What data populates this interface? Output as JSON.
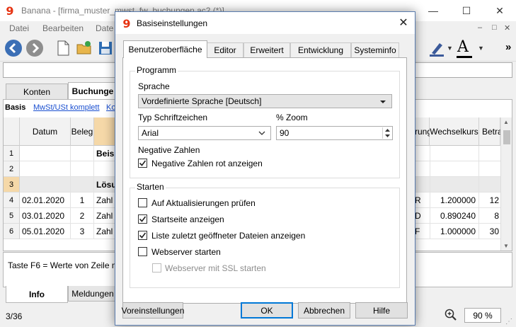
{
  "window": {
    "title": "Banana - [firma_muster_mwst_fw_buchungen.ac2 (*)]",
    "controls": {
      "minimize": "—",
      "maximize": "☐",
      "close": "✕"
    }
  },
  "menu": [
    "Datei",
    "Bearbeiten",
    "Date"
  ],
  "mdi_controls": [
    "‒",
    "□",
    "✕"
  ],
  "toolbar": {
    "more": "»",
    "font_letter": "A"
  },
  "table_tabs": [
    "Konten",
    "Buchunge"
  ],
  "views": [
    "Basis",
    "MwSt/USt komplett",
    "Ko"
  ],
  "columns": {
    "datum": "Datum",
    "beleg": "Beleg",
    "waehrung": "rung",
    "wechselkurs": "Wechselkurs",
    "betrag": "Betra"
  },
  "rows": [
    {
      "num": "1",
      "datum": "",
      "beleg": "",
      "text": "Beis",
      "whg": "",
      "kurs": "",
      "betrag": ""
    },
    {
      "num": "2",
      "datum": "",
      "beleg": "",
      "text": "",
      "whg": "",
      "kurs": "",
      "betrag": ""
    },
    {
      "num": "3",
      "datum": "",
      "beleg": "",
      "text": "Lösu",
      "whg": "",
      "kurs": "",
      "betrag": ""
    },
    {
      "num": "4",
      "datum": "02.01.2020",
      "beleg": "1",
      "text": "Zahl",
      "whg": "R",
      "kurs": "1.200000",
      "betrag": "12"
    },
    {
      "num": "5",
      "datum": "03.01.2020",
      "beleg": "2",
      "text": "Zahl",
      "whg": "D",
      "kurs": "0.890240",
      "betrag": "8"
    },
    {
      "num": "6",
      "datum": "05.01.2020",
      "beleg": "3",
      "text": "Zahl",
      "whg": "F",
      "kurs": "1.000000",
      "betrag": "30"
    }
  ],
  "info": {
    "text": "Taste F6 = Werte von Zeile mit"
  },
  "bottom_tabs": [
    "Info",
    "Meldungen"
  ],
  "status": {
    "position": "3/36",
    "zoom": "90 %"
  },
  "dialog": {
    "title": "Basiseinstellungen",
    "tabs": [
      "Benutzeroberfläche",
      "Editor",
      "Erweitert",
      "Entwicklung",
      "Systeminfo"
    ],
    "programm": {
      "legend": "Programm",
      "sprache_label": "Sprache",
      "sprache_value": "Vordefinierte Sprache [Deutsch]",
      "font_label": "Typ Schriftzeichen",
      "font_value": "Arial",
      "zoom_label": "% Zoom",
      "zoom_value": "90",
      "neg_label": "Negative Zahlen",
      "neg_checkbox": "Negative Zahlen rot anzeigen"
    },
    "starten": {
      "legend": "Starten",
      "options": [
        {
          "label": "Auf Aktualisierungen prüfen",
          "checked": false
        },
        {
          "label": "Startseite anzeigen",
          "checked": true
        },
        {
          "label": "Liste zuletzt geöffneter Dateien anzeigen",
          "checked": true
        },
        {
          "label": "Webserver starten",
          "checked": false
        },
        {
          "label": "Webserver mit SSL starten",
          "checked": false
        }
      ]
    },
    "buttons": {
      "defaults": "Voreinstellungen",
      "ok": "OK",
      "cancel": "Abbrechen",
      "help": "Hilfe"
    }
  },
  "colors": {
    "accent": "#0078d7",
    "logo_red": "#e63312",
    "row_highlight": "#eaeaea",
    "orange_col": "#f5d8a8"
  }
}
